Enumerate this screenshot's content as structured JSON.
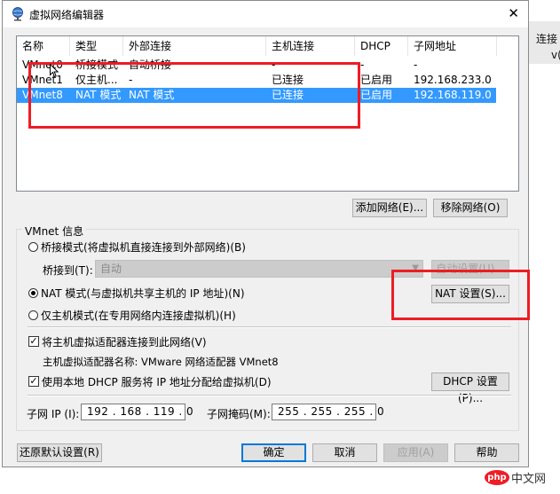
{
  "window": {
    "title": "虚拟网络编辑器",
    "close_glyph": "✕"
  },
  "background": {
    "right_text_1": "连接",
    "right_text_2": "v("
  },
  "network_table": {
    "columns": [
      "名称",
      "类型",
      "外部连接",
      "主机连接",
      "DHCP",
      "子网地址"
    ],
    "rows": [
      [
        "VMnet0",
        "桥接模式",
        "自动桥接",
        "-",
        "-",
        "-"
      ],
      [
        "VMnet1",
        "仅主机...",
        "-",
        "已连接",
        "已启用",
        "192.168.233.0"
      ],
      [
        "VMnet8",
        "NAT 模式",
        "NAT 模式",
        "已连接",
        "已启用",
        "192.168.119.0"
      ]
    ],
    "selected_index": 2
  },
  "buttons": {
    "add_network": "添加网络(E)...",
    "remove_network": "移除网络(O)",
    "auto_settings": "自动设置(U)...",
    "nat_settings": "NAT 设置(S)...",
    "dhcp_settings": "DHCP 设置(P)...",
    "restore_defaults": "还原默认设置(R)",
    "ok": "确定",
    "cancel": "取消",
    "apply": "应用(A)",
    "help": "帮助"
  },
  "vmnet_info": {
    "group_title": "VMnet 信息",
    "radio_bridged": "桥接模式(将虚拟机直接连接到外部网络)(B)",
    "bridged_to_label": "桥接到(T):",
    "bridged_to_value": "自动",
    "radio_nat": "NAT 模式(与虚拟机共享主机的 IP 地址)(N)",
    "radio_hostonly": "仅主机模式(在专用网络内连接虚拟机)(H)",
    "selected_mode": "nat",
    "check_connect_adapter": "将主机虚拟适配器连接到此网络(V)",
    "connect_adapter_checked": true,
    "adapter_name_label": "主机虚拟适配器名称: VMware 网络适配器 VMnet8",
    "check_dhcp": "使用本地 DHCP 服务将 IP 地址分配给虚拟机(D)",
    "dhcp_checked": true,
    "check_mark": "✓"
  },
  "subnet": {
    "ip_label": "子网 IP (I):",
    "ip_value": "192 . 168 . 119 .  0",
    "mask_label": "子网掩码(M):",
    "mask_value": "255 . 255 . 255 .  0"
  },
  "watermark": {
    "badge": "php",
    "text": "中文网"
  },
  "colors": {
    "selection": "#3399ff",
    "highlight_red": "#ee1c24",
    "default_button": "#0078d7"
  }
}
